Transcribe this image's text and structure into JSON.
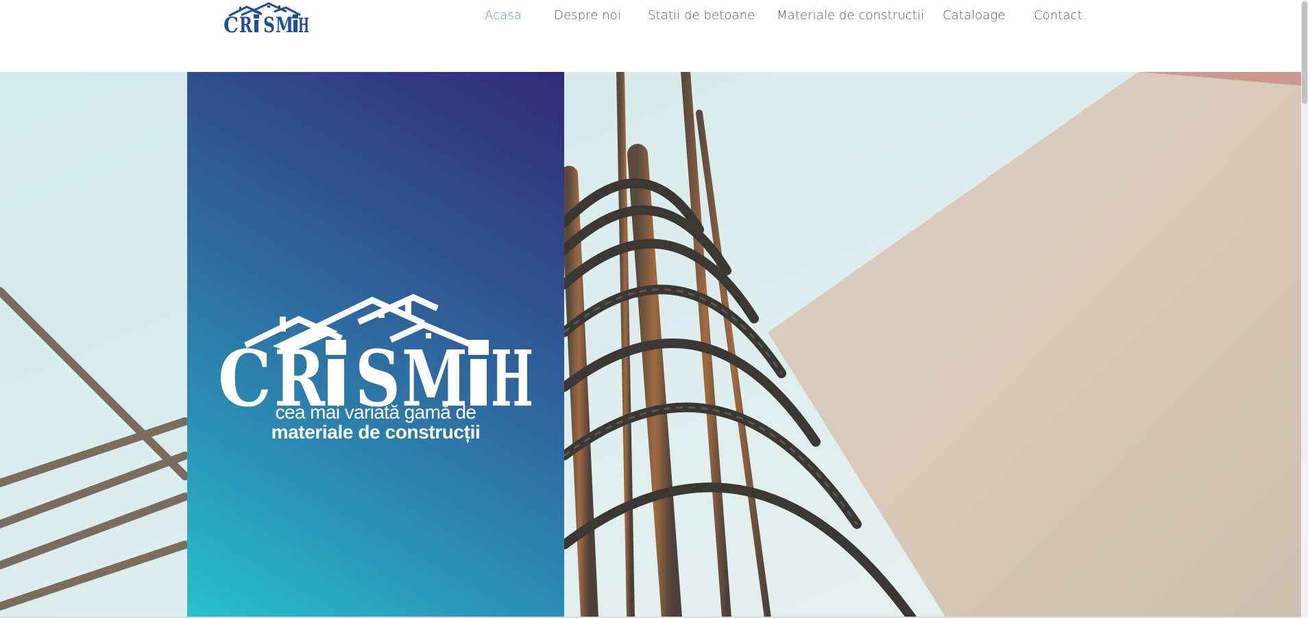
{
  "header": {
    "logo": {
      "text": "CRiSMiH",
      "color": "#1f4e9b",
      "icon": "house-roofs-logo"
    }
  },
  "nav": {
    "items": [
      {
        "label": "Acasa",
        "active": true
      },
      {
        "label": "Despre noi",
        "active": false
      },
      {
        "label": "Statii de betoane",
        "active": false
      },
      {
        "label": "Materiale de constructii",
        "active": false
      },
      {
        "label": "Cataloage",
        "active": false
      },
      {
        "label": "Contact",
        "active": false
      }
    ],
    "active_color": "#4aa3d9",
    "text_color": "#555a5e"
  },
  "hero": {
    "brand": "CRiSMiH",
    "tagline_line1": "cea mai variată gamă de",
    "tagline_line2": "materiale de construcții",
    "panel_gradient": [
      "#26c2cc",
      "#2f5f99",
      "#322a76"
    ],
    "photo": "rebar-reinforcement-concrete-wall"
  }
}
